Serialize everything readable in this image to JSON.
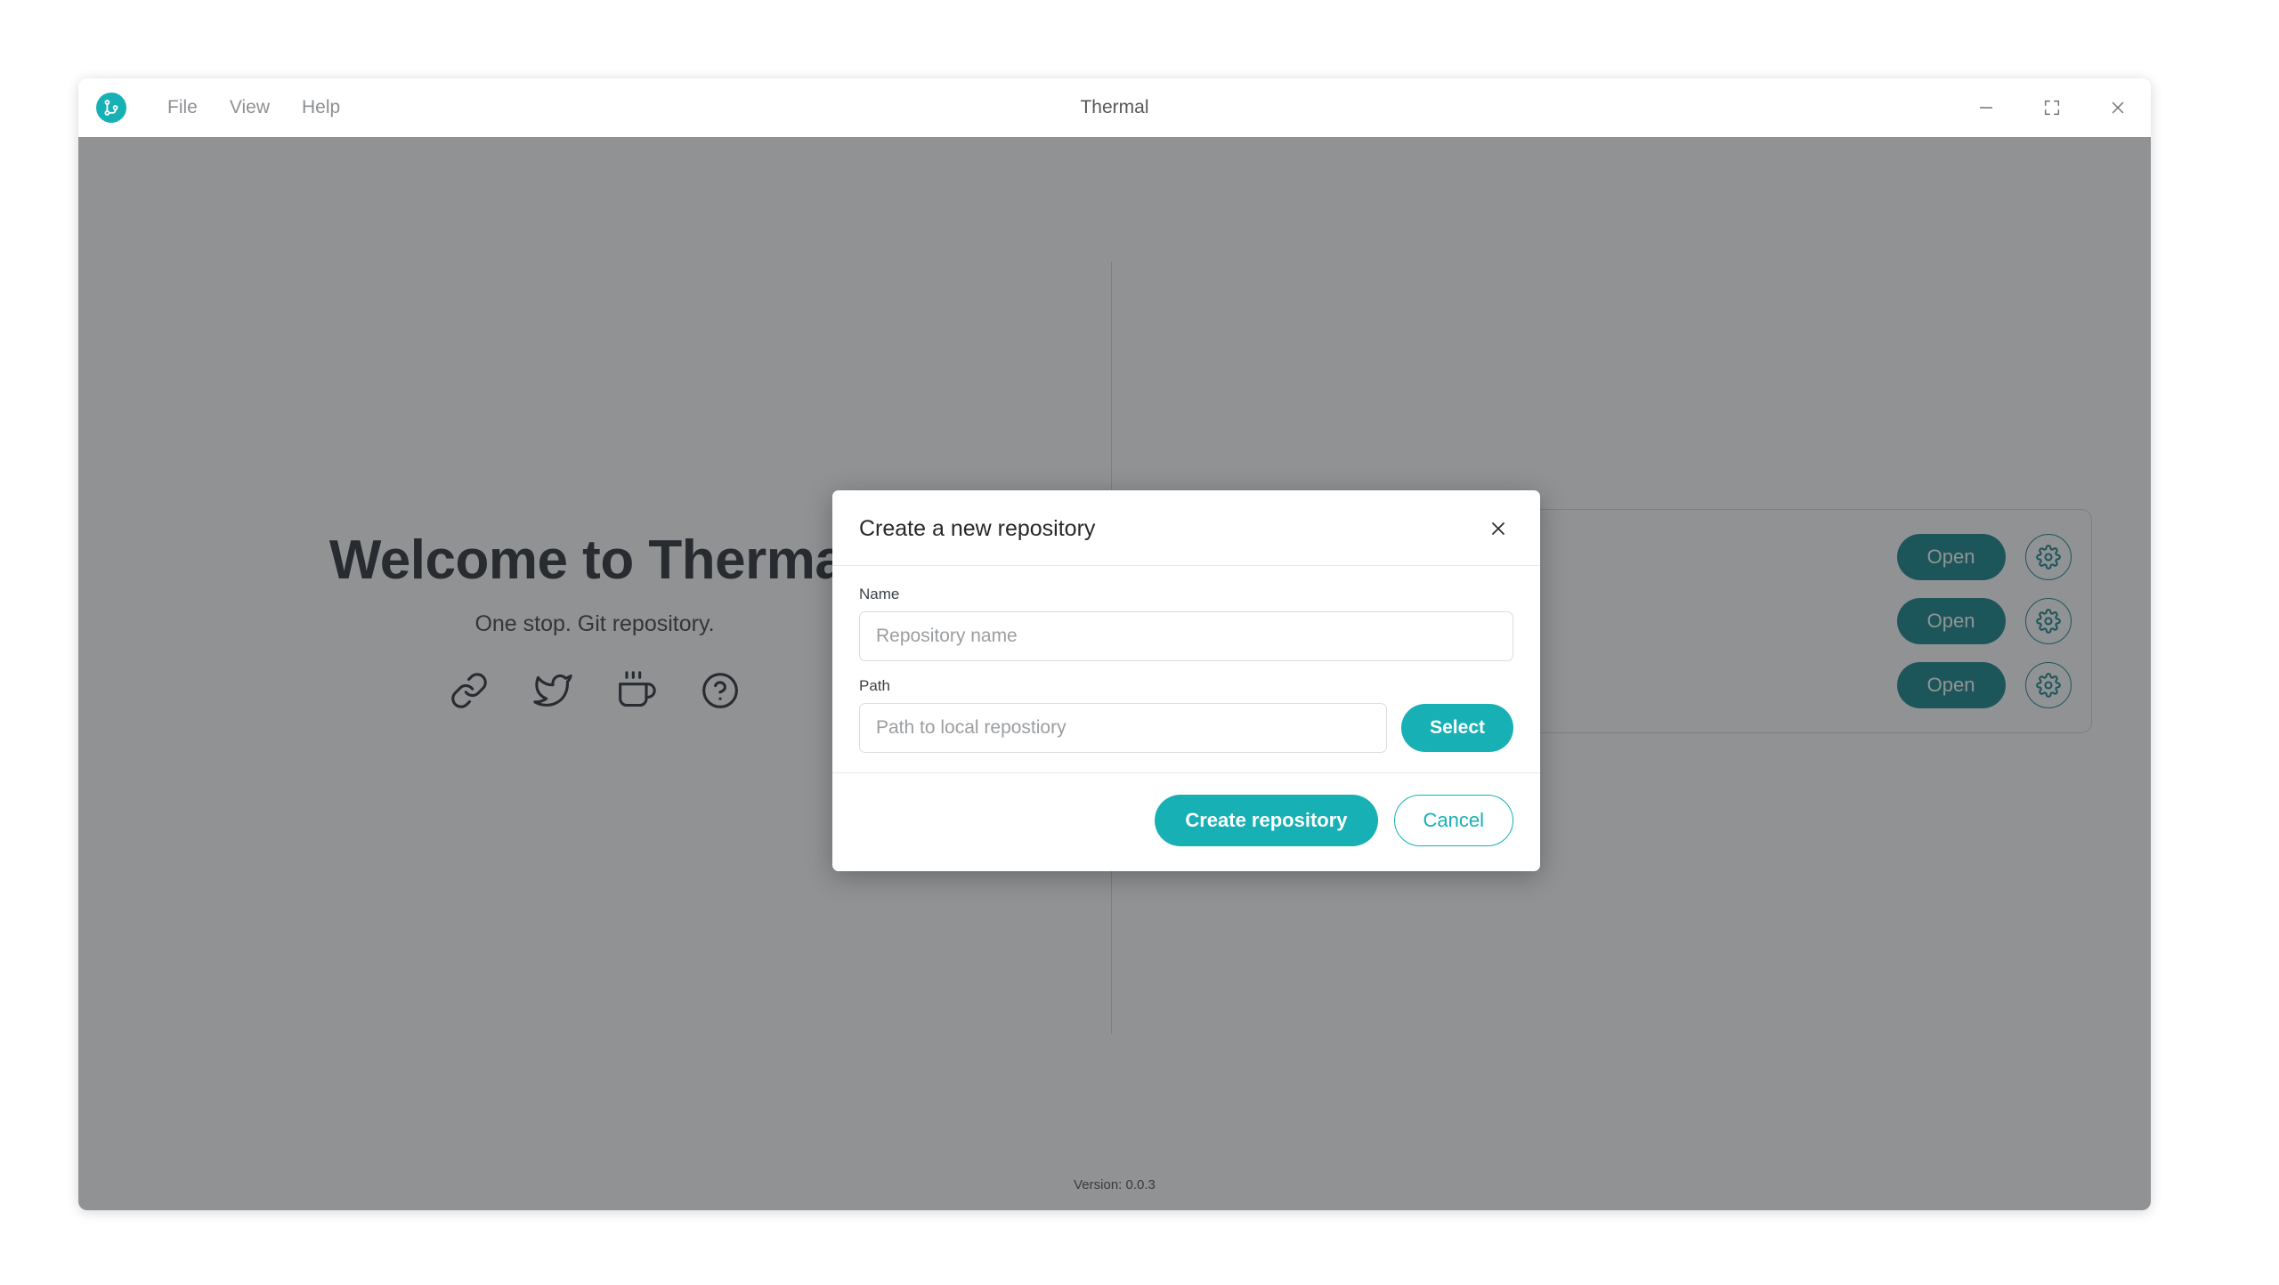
{
  "window": {
    "title": "Thermal",
    "logo_icon": "git-branch-logo-icon",
    "menu": [
      {
        "label": "File"
      },
      {
        "label": "View"
      },
      {
        "label": "Help"
      }
    ],
    "controls": {
      "minimize": "minimize-icon",
      "maximize": "maximize-icon",
      "close": "close-icon"
    }
  },
  "welcome": {
    "title": "Welcome to Thermal",
    "subtitle": "One stop. Git repository.",
    "social": [
      {
        "name": "link-icon",
        "label": "Website link"
      },
      {
        "name": "twitter-icon",
        "label": "Twitter"
      },
      {
        "name": "coffee-icon",
        "label": "Buy me a coffee"
      },
      {
        "name": "question-circle-icon",
        "label": "Help"
      }
    ]
  },
  "repositories": {
    "open_label": "Open",
    "settings_icon": "gear-icon",
    "rows": [
      {
        "name": ""
      },
      {
        "name": ""
      },
      {
        "name": ""
      }
    ]
  },
  "footer": {
    "version": "Version: 0.0.3"
  },
  "modal": {
    "title": "Create a new repository",
    "close_icon": "close-icon",
    "name_field": {
      "label": "Name",
      "placeholder": "Repository name",
      "value": ""
    },
    "path_field": {
      "label": "Path",
      "placeholder": "Path to local repostiory",
      "value": "",
      "select_label": "Select"
    },
    "create_label": "Create repository",
    "cancel_label": "Cancel"
  },
  "colors": {
    "accent": "#17b0b5",
    "accent_dark": "#0e7f84",
    "overlay": "rgba(45,48,51,0.52)"
  }
}
